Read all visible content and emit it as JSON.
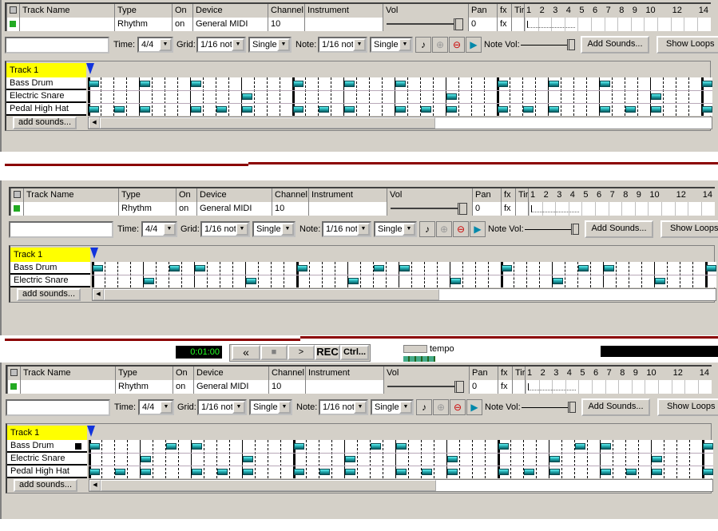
{
  "columns": {
    "track_name": "Track Name",
    "type": "Type",
    "on": "On",
    "device": "Device",
    "channel": "Channel",
    "instrument": "Instrument",
    "vol": "Vol",
    "pan": "Pan",
    "fx": "fx",
    "tir": "Tir"
  },
  "track": {
    "name": "Track 1",
    "type": "Rhythm",
    "on": "on",
    "device": "General MIDI",
    "channel": "10",
    "instrument": "",
    "vol": 100,
    "pan": "0",
    "fx": "fx"
  },
  "bar_numbers": [
    "1",
    "2",
    "3",
    "4",
    "5",
    "6",
    "7",
    "8",
    "9",
    "10",
    "12",
    "14"
  ],
  "toolbar": {
    "search_value": "",
    "time_label": "Time:",
    "time_value": "4/4",
    "grid_label": "Grid:",
    "grid_value": "1/16 not",
    "grid_mode": "Single",
    "note_label": "Note:",
    "note_value": "1/16 not",
    "note_mode": "Single",
    "note_vol_label": "Note Vol:",
    "note_vol": 100,
    "add_sounds": "Add Sounds...",
    "show_loops": "Show Loops"
  },
  "icons": [
    "metronome-icon",
    "zoom-in-icon",
    "zoom-out-icon",
    "snap-to-end-icon"
  ],
  "roll": {
    "track_label": "Track 1",
    "add_sounds": "add sounds...",
    "steps_per_bar": 16
  },
  "colors": {
    "note": "#1a9aa0",
    "track_label_bg": "#ffff00",
    "divider": "#8b0000",
    "panel": "#d4d0c8"
  },
  "transport": {
    "time": "0:01:00",
    "rewind": "«",
    "stop": "■",
    "play": ">",
    "rec": "REC",
    "ctrl": "Ctrl...",
    "tempo": "tempo"
  },
  "panels": [
    {
      "rows": [
        {
          "name": "Bass Drum",
          "notes": [
            0,
            4,
            8,
            16,
            20,
            24,
            32,
            36,
            40,
            48
          ]
        },
        {
          "name": "Electric Snare",
          "notes": [
            12,
            28,
            44
          ]
        },
        {
          "name": "Pedal High Hat",
          "notes": [
            0,
            2,
            4,
            8,
            10,
            12,
            16,
            18,
            20,
            24,
            26,
            28,
            32,
            34,
            36,
            40,
            42,
            44,
            48
          ]
        }
      ]
    },
    {
      "rows": [
        {
          "name": "Bass Drum",
          "notes": [
            0,
            6,
            8,
            16,
            22,
            24,
            32,
            38,
            40,
            48
          ]
        },
        {
          "name": "Electric Snare",
          "notes": [
            4,
            12,
            20,
            28,
            36,
            44
          ]
        }
      ]
    },
    {
      "rows": [
        {
          "name": "Bass Drum",
          "notes": [
            0,
            6,
            8,
            16,
            22,
            24,
            32,
            38,
            40,
            48
          ]
        },
        {
          "name": "Electric Snare",
          "notes": [
            4,
            12,
            20,
            28,
            36,
            44
          ]
        },
        {
          "name": "Pedal High Hat",
          "notes": [
            0,
            2,
            4,
            8,
            10,
            12,
            16,
            18,
            20,
            24,
            26,
            28,
            32,
            34,
            36,
            40,
            42,
            44,
            48
          ]
        }
      ]
    }
  ]
}
